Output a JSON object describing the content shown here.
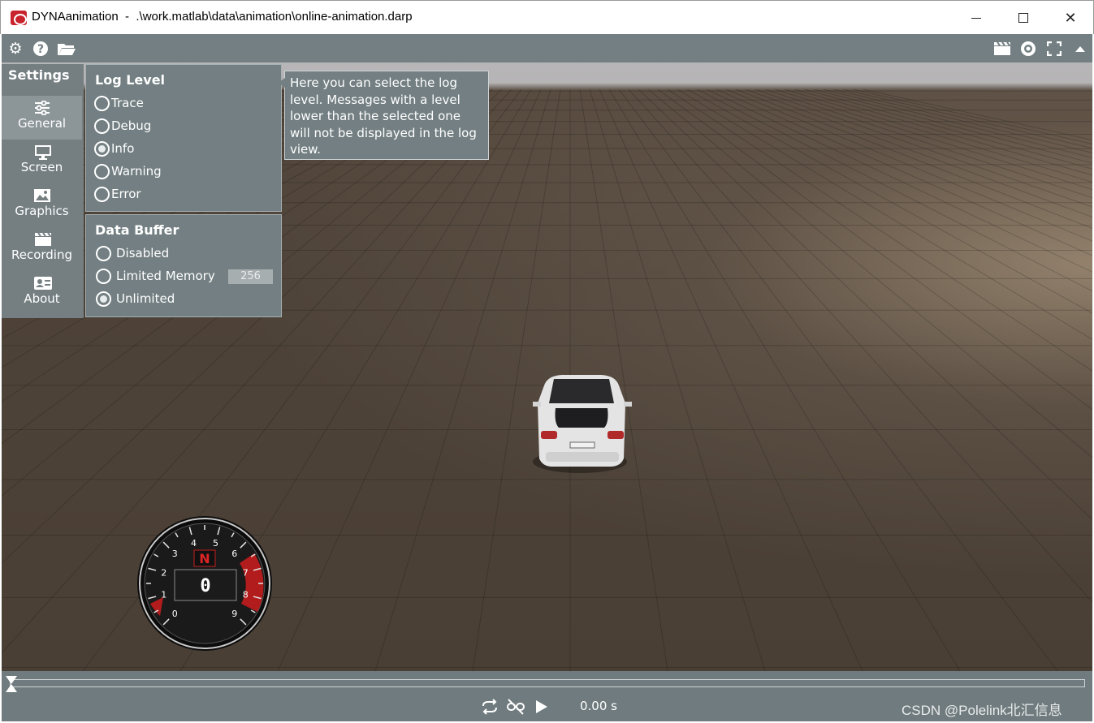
{
  "window": {
    "title": "DYNAanimation  -  .\\work.matlab\\data\\animation\\online-animation.darp",
    "controls": [
      "minimize",
      "maximize",
      "close"
    ]
  },
  "toolbar": {
    "left_icons": [
      "gear-icon",
      "help-icon",
      "folder-open-icon"
    ],
    "right_icons": [
      "clapperboard-icon",
      "eye-icon",
      "fullscreen-icon",
      "collapse-up-icon"
    ]
  },
  "settings": {
    "title": "Settings",
    "nav": [
      {
        "label": "General",
        "icon": "sliders-icon",
        "active": true
      },
      {
        "label": "Screen",
        "icon": "monitor-icon",
        "active": false
      },
      {
        "label": "Graphics",
        "icon": "image-icon",
        "active": false
      },
      {
        "label": "Recording",
        "icon": "clapperboard-icon",
        "active": false
      },
      {
        "label": "About",
        "icon": "id-card-icon",
        "active": false
      }
    ],
    "log_level": {
      "title": "Log Level",
      "options": [
        "Trace",
        "Debug",
        "Info",
        "Warning",
        "Error"
      ],
      "selected": "Info"
    },
    "data_buffer": {
      "title": "Data Buffer",
      "options": [
        "Disabled",
        "Limited Memory",
        "Unlimited"
      ],
      "selected": "Unlimited",
      "limited_memory_value": "256"
    }
  },
  "tooltip": {
    "text": "Here you can select the log level. Messages with a level lower than the selected one will not be displayed in the log view."
  },
  "gauge": {
    "ticks": [
      "0",
      "1",
      "2",
      "3",
      "4",
      "5",
      "6",
      "7",
      "8",
      "9"
    ],
    "gear_indicator": "N",
    "speed_display": "0"
  },
  "playback": {
    "controls": [
      "loop-icon",
      "unlink-icon",
      "play-icon"
    ],
    "time": "0.00 s"
  },
  "watermark": "CSDN @Polelink北汇信息"
}
